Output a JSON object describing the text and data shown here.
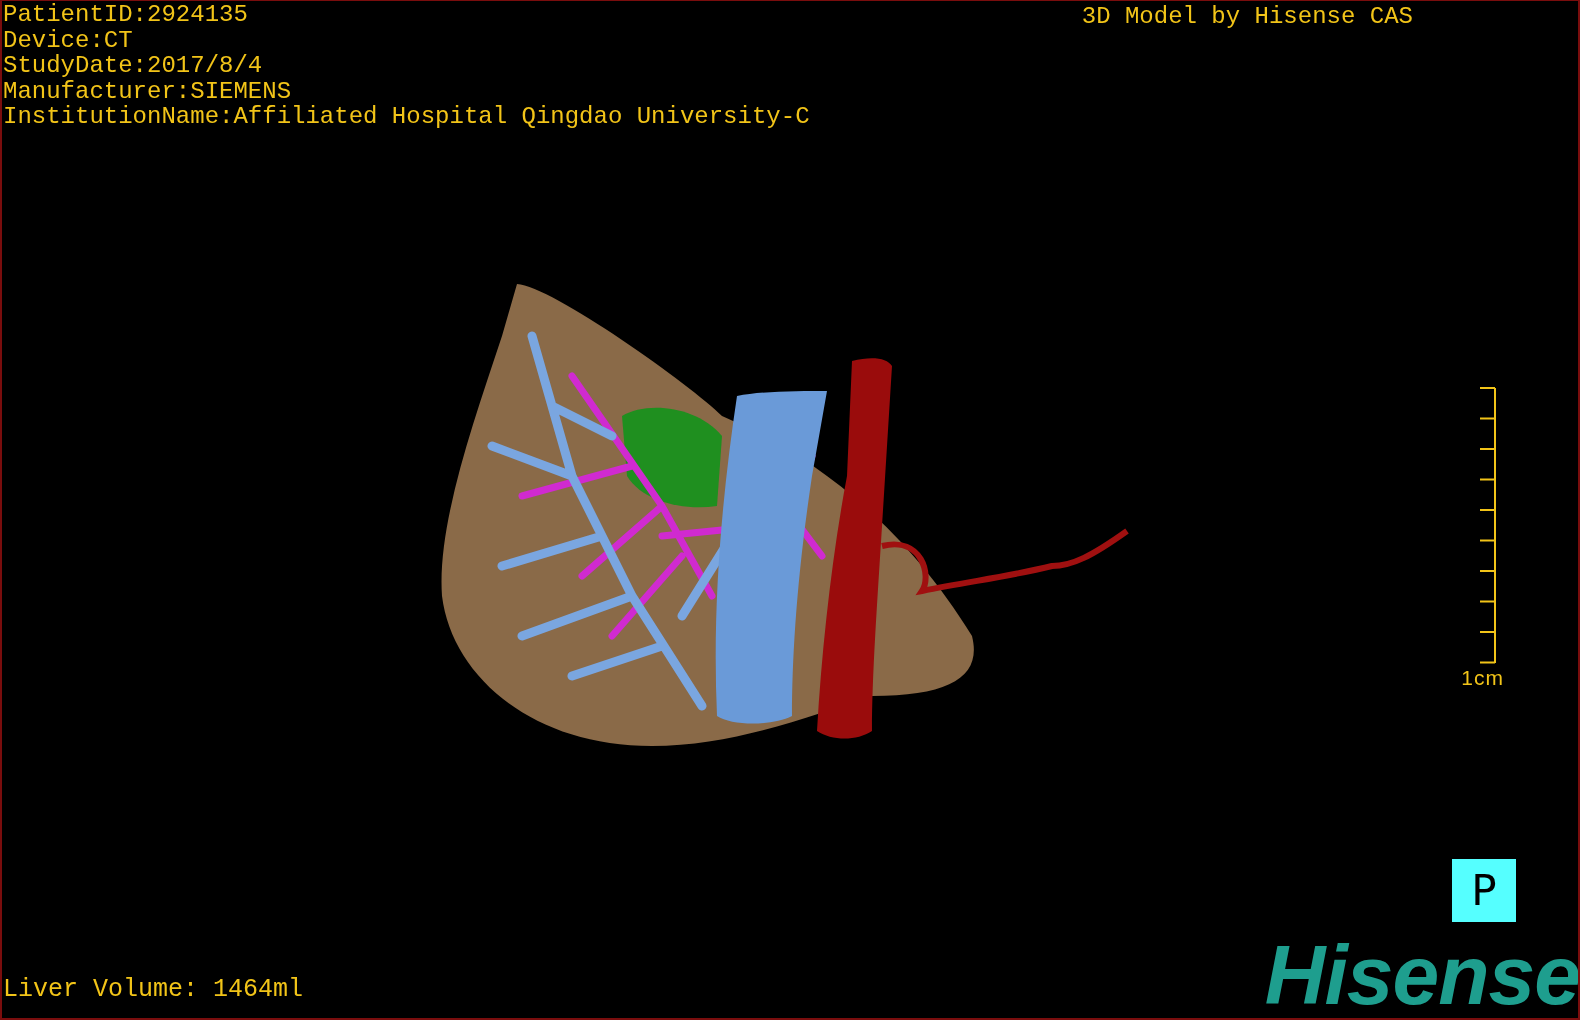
{
  "info_lines": [
    "PatientID:2924135",
    "Device:CT",
    "StudyDate:2017/8/4",
    "Manufacturer:SIEMENS",
    "InstitutionName:Affiliated Hospital Qingdao University-C"
  ],
  "title": "3D Model by Hisense CAS",
  "scale": {
    "label": "1cm"
  },
  "orientation_button": {
    "label": "P"
  },
  "volume": "Liver Volume: 1464ml",
  "logo": "Hisense"
}
